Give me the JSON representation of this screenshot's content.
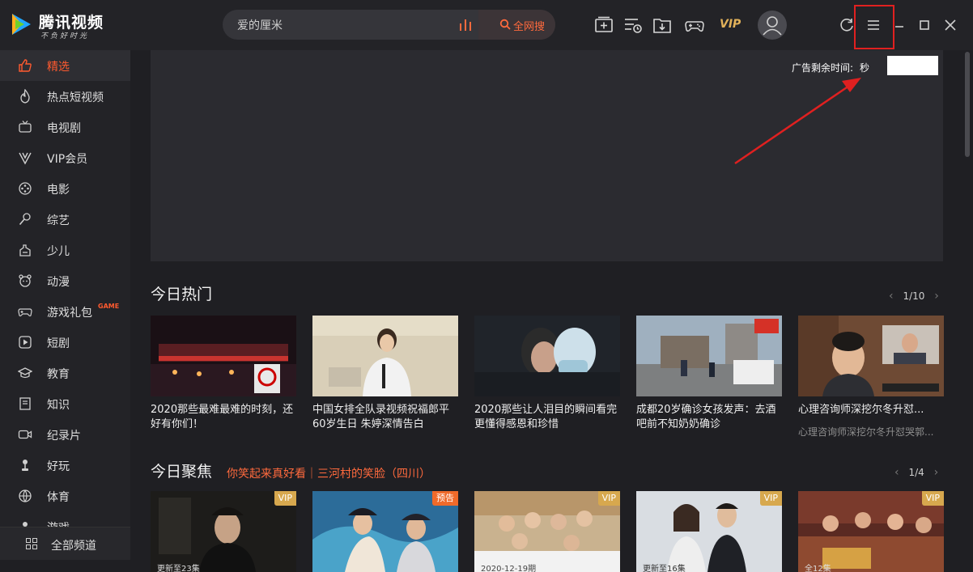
{
  "app": {
    "name": "腾讯视频",
    "slogan": "不负好时光",
    "colors": {
      "accent": "#ff6a3d",
      "background": "#1f1f23",
      "vip_gold": "#e2b25a",
      "annotation_red": "#e02020"
    }
  },
  "search": {
    "query": "爱的厘米",
    "button_label": "全网搜",
    "icons": {
      "trend": "bar-chart-icon",
      "button": "search-icon"
    }
  },
  "toolbar": {
    "vip_label": "VIP",
    "icons": [
      "add-video-icon",
      "playlist-icon",
      "download-icon",
      "gamepad-icon",
      "avatar-icon",
      "refresh-icon",
      "menu-icon",
      "minimize-icon",
      "maximize-icon",
      "close-icon"
    ]
  },
  "sidebar": {
    "items": [
      {
        "label": "精选",
        "icon": "thumbs-up-icon",
        "active": true
      },
      {
        "label": "热点短视频",
        "icon": "flame-icon"
      },
      {
        "label": "电视剧",
        "icon": "tv-icon"
      },
      {
        "label": "VIP会员",
        "icon": "vip-icon"
      },
      {
        "label": "电影",
        "icon": "film-reel-icon"
      },
      {
        "label": "综艺",
        "icon": "microphone-icon"
      },
      {
        "label": "少儿",
        "icon": "kid-icon"
      },
      {
        "label": "动漫",
        "icon": "bear-icon"
      },
      {
        "label": "游戏礼包",
        "icon": "gamepad-icon",
        "tag": "GAME"
      },
      {
        "label": "短剧",
        "icon": "play-square-icon"
      },
      {
        "label": "教育",
        "icon": "graduation-cap-icon"
      },
      {
        "label": "知识",
        "icon": "book-icon"
      },
      {
        "label": "纪录片",
        "icon": "camera-icon"
      },
      {
        "label": "好玩",
        "icon": "joystick-icon"
      },
      {
        "label": "体育",
        "icon": "basketball-icon"
      },
      {
        "label": "游戏",
        "icon": "game-icon"
      }
    ],
    "all_channels_label": "全部频道"
  },
  "ad": {
    "timer_label": "广告剩余时间:",
    "timer_unit": "秒"
  },
  "hot": {
    "title": "今日热门",
    "page": "1/10",
    "cards": [
      {
        "title": "2020那些最难最难的时刻，还好有你们！",
        "sub": ""
      },
      {
        "title": "中国女排全队录视频祝福郎平60岁生日 朱婷深情告白",
        "sub": ""
      },
      {
        "title": "2020那些让人泪目的瞬间看完更懂得感恩和珍惜",
        "sub": ""
      },
      {
        "title": "成都20岁确诊女孩发声：去酒吧前不知奶奶确诊",
        "sub": ""
      },
      {
        "title": "心理咨询师深挖尔冬升怼...",
        "sub": "心理咨询师深挖尔冬升怼哭郭..."
      }
    ]
  },
  "focus": {
    "title": "今日聚焦",
    "subtitle": "你笑起来真好看｜三河村的笑脸（四川）",
    "page": "1/4",
    "cards": [
      {
        "badge": "VIP",
        "caption": "更新至23集"
      },
      {
        "badge": "预告",
        "caption": ""
      },
      {
        "badge": "VIP",
        "caption": "2020-12-19期"
      },
      {
        "badge": "VIP",
        "caption": "更新至16集"
      },
      {
        "badge": "VIP",
        "caption": "全12集"
      }
    ]
  }
}
